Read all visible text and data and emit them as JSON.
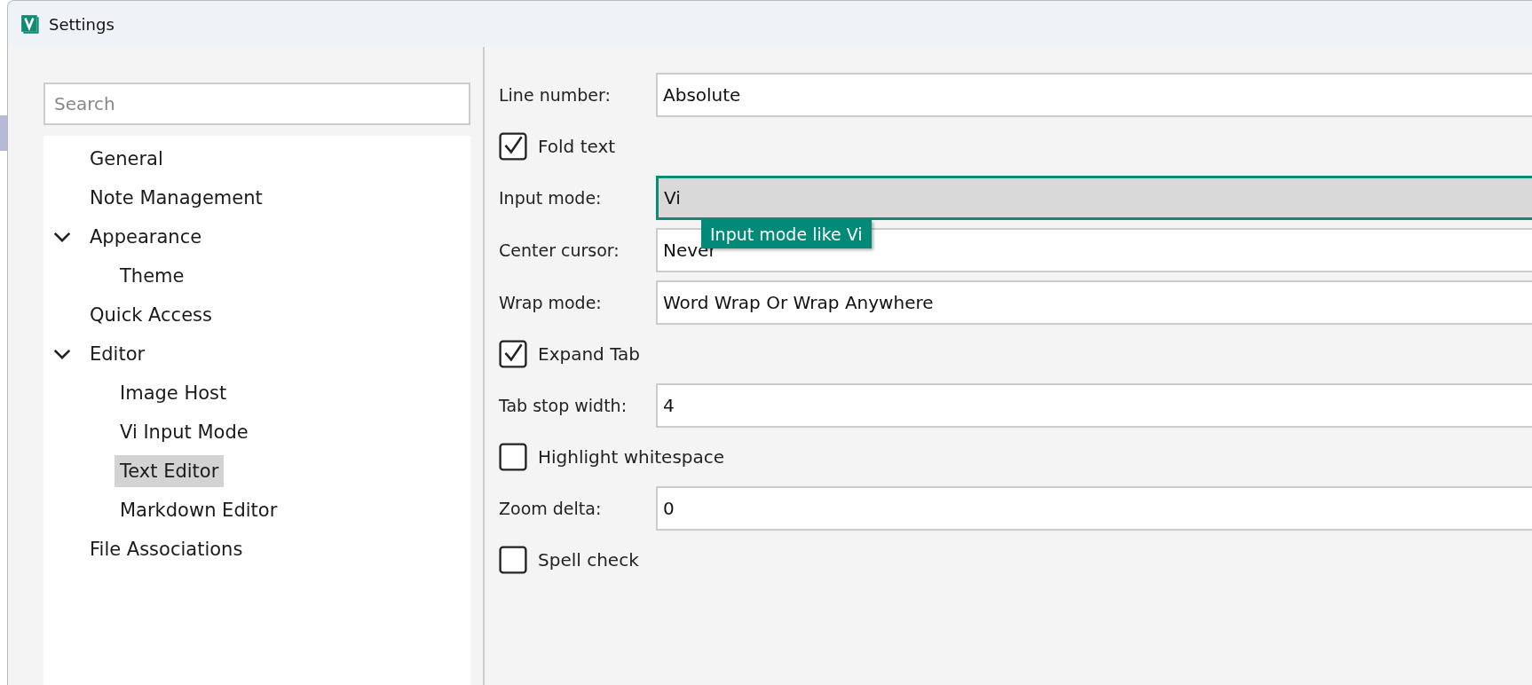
{
  "window": {
    "title": "Settings"
  },
  "search": {
    "placeholder": "Search"
  },
  "tree": [
    {
      "label": "General",
      "selected": false
    },
    {
      "label": "Note Management",
      "selected": false
    },
    {
      "label": "Appearance",
      "selected": false,
      "expanded": true,
      "children": [
        {
          "label": "Theme",
          "selected": false
        }
      ]
    },
    {
      "label": "Quick Access",
      "selected": false
    },
    {
      "label": "Editor",
      "selected": false,
      "expanded": true,
      "children": [
        {
          "label": "Image Host",
          "selected": false
        },
        {
          "label": "Vi Input Mode",
          "selected": false
        },
        {
          "label": "Text Editor",
          "selected": true
        },
        {
          "label": "Markdown Editor",
          "selected": false
        }
      ]
    },
    {
      "label": "File Associations",
      "selected": false
    }
  ],
  "settings": [
    {
      "kind": "field",
      "label": "Line number:",
      "value": "Absolute",
      "focused": false
    },
    {
      "kind": "checkbox",
      "label": "Fold text",
      "checked": true
    },
    {
      "kind": "field",
      "label": "Input mode:",
      "value": "Vi",
      "focused": true
    },
    {
      "kind": "field",
      "label": "Center cursor:",
      "value": "Never",
      "focused": false
    },
    {
      "kind": "field",
      "label": "Wrap mode:",
      "value": "Word Wrap Or Wrap Anywhere",
      "focused": false
    },
    {
      "kind": "checkbox",
      "label": "Expand Tab",
      "checked": true
    },
    {
      "kind": "field",
      "label": "Tab stop width:",
      "value": "4",
      "focused": false
    },
    {
      "kind": "checkbox",
      "label": "Highlight whitespace",
      "checked": false
    },
    {
      "kind": "field",
      "label": "Zoom delta:",
      "value": "0",
      "focused": false
    },
    {
      "kind": "checkbox",
      "label": "Spell check",
      "checked": false
    }
  ],
  "tooltip": "Input mode like Vi"
}
